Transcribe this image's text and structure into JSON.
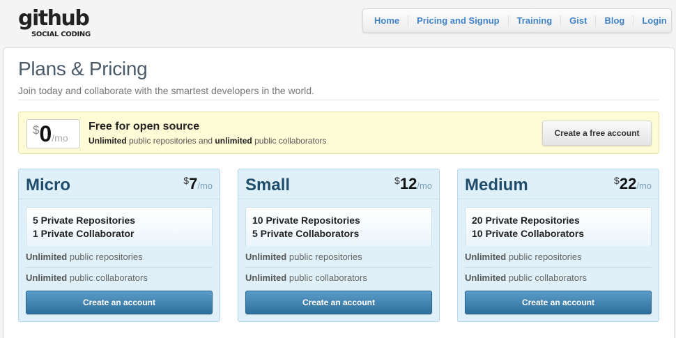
{
  "brand": {
    "logo_word": "github",
    "logo_tagline": "SOCIAL CODING"
  },
  "nav": [
    {
      "label": "Home"
    },
    {
      "label": "Pricing and Signup"
    },
    {
      "label": "Training"
    },
    {
      "label": "Gist"
    },
    {
      "label": "Blog"
    },
    {
      "label": "Login"
    }
  ],
  "page": {
    "title": "Plans & Pricing",
    "subtitle": "Join today and collaborate with the smartest developers in the world."
  },
  "free_plan": {
    "currency": "$",
    "amount": "0",
    "period": "/mo",
    "title": "Free for open source",
    "desc_bold_1": "Unlimited",
    "desc_text_1": " public repositories and ",
    "desc_bold_2": "unlimited",
    "desc_text_2": " public collaborators",
    "button_label": "Create a free account"
  },
  "plans": [
    {
      "name": "Micro",
      "currency": "$",
      "amount": "7",
      "period": "/mo",
      "feature_1": "5 Private Repositories",
      "feature_2": "1 Private Collaborator",
      "row1_bold": "Unlimited",
      "row1_text": " public repositories",
      "row2_bold": "Unlimited",
      "row2_text": " public collaborators",
      "button_label": "Create an account"
    },
    {
      "name": "Small",
      "currency": "$",
      "amount": "12",
      "period": "/mo",
      "feature_1": "10 Private Repositories",
      "feature_2": "5 Private Collaborators",
      "row1_bold": "Unlimited",
      "row1_text": " public repositories",
      "row2_bold": "Unlimited",
      "row2_text": " public collaborators",
      "button_label": "Create an account"
    },
    {
      "name": "Medium",
      "currency": "$",
      "amount": "22",
      "period": "/mo",
      "feature_1": "20 Private Repositories",
      "feature_2": "10 Private Collaborators",
      "row1_bold": "Unlimited",
      "row1_text": " public repositories",
      "row2_bold": "Unlimited",
      "row2_text": " public collaborators",
      "button_label": "Create an account"
    }
  ],
  "colors": {
    "link": "#4183c4",
    "free_bg": "#fefbd7",
    "plan_bg": "#dff0f8",
    "plan_title": "#1f4c6b",
    "button_blue": "#3a7fad"
  }
}
